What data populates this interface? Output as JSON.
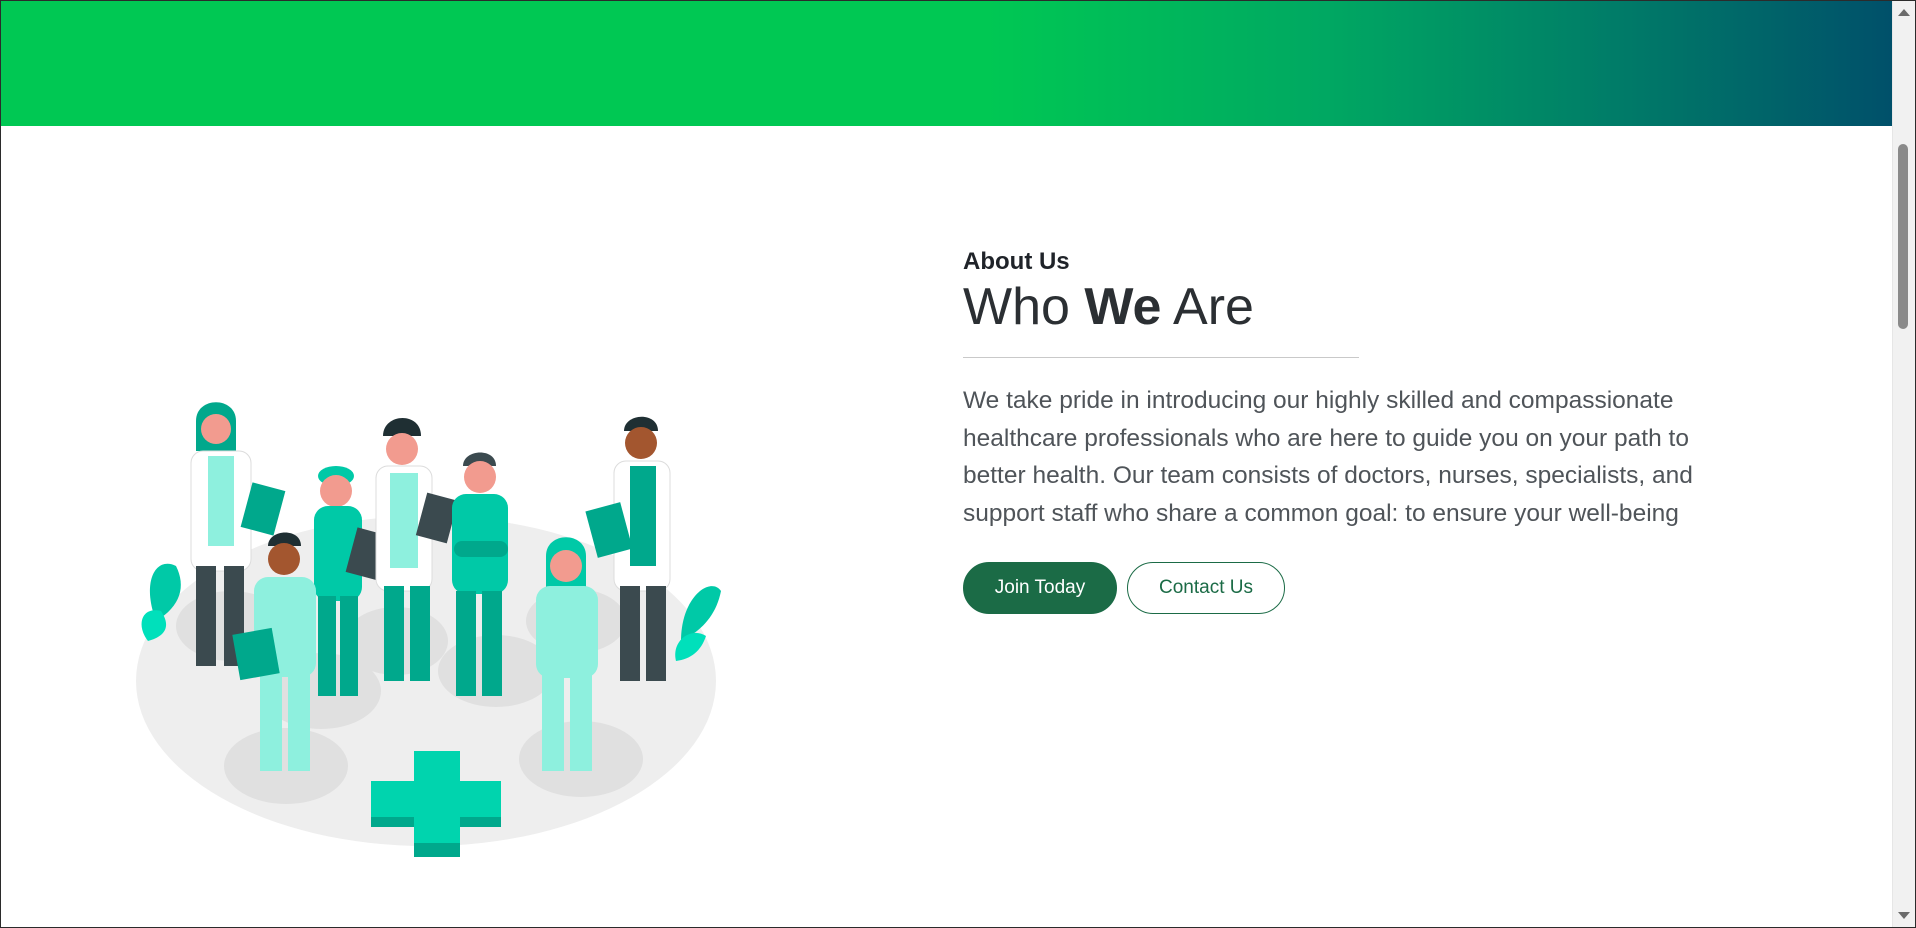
{
  "header": {
    "gradient_start": "#00c853",
    "gradient_end": "#00506a"
  },
  "about": {
    "eyebrow": "About Us",
    "headline_part1": "Who ",
    "headline_emphasis": "We",
    "headline_part2": " Are",
    "body": "We take pride in introducing our highly skilled and compassionate healthcare professionals who are here to guide you on your path to better health. Our team consists of doctors, nurses, specialists, and support staff who share a common goal: to ensure your well-being"
  },
  "buttons": {
    "join_label": "Join Today",
    "contact_label": "Contact Us"
  },
  "colors": {
    "accent": "#1b6b46",
    "illustration_primary": "#00c9a7",
    "illustration_light": "#8ef0de"
  },
  "illustration": {
    "icon": "medical-team-illustration"
  }
}
